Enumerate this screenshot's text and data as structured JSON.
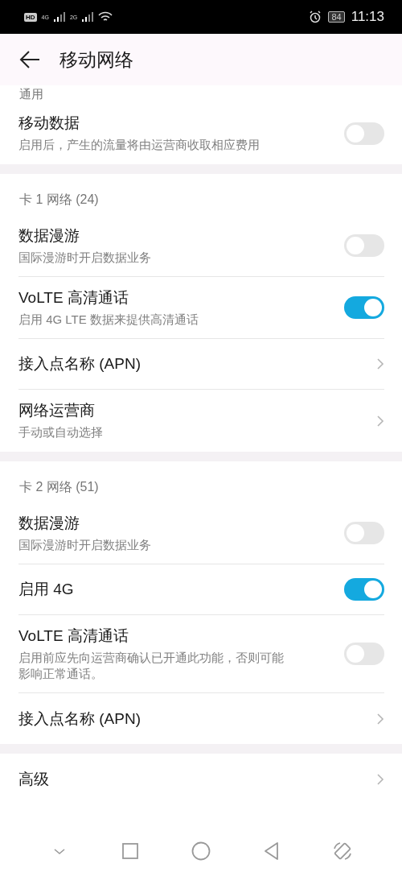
{
  "status_bar": {
    "left": [
      "HD",
      "4G",
      "2G"
    ],
    "battery": "84",
    "time": "11:13"
  },
  "header": {
    "title": "移动网络"
  },
  "sections": [
    {
      "title": "通用",
      "items": [
        {
          "kind": "toggle",
          "title": "移动数据",
          "subtitle": "启用后，产生的流量将由运营商收取相应费用",
          "on": false
        }
      ]
    },
    {
      "title": "卡 1 网络 (24)",
      "items": [
        {
          "kind": "toggle",
          "title": "数据漫游",
          "subtitle": "国际漫游时开启数据业务",
          "on": false
        },
        {
          "kind": "toggle",
          "title": "VoLTE 高清通话",
          "subtitle": "启用 4G LTE 数据来提供高清通话",
          "on": true
        },
        {
          "kind": "link",
          "title": "接入点名称 (APN)"
        },
        {
          "kind": "link",
          "title": "网络运营商",
          "subtitle": "手动或自动选择"
        }
      ]
    },
    {
      "title": "卡 2 网络 (51)",
      "items": [
        {
          "kind": "toggle",
          "title": "数据漫游",
          "subtitle": "国际漫游时开启数据业务",
          "on": false
        },
        {
          "kind": "toggle",
          "title": "启用 4G",
          "on": true
        },
        {
          "kind": "toggle",
          "title": "VoLTE 高清通话",
          "subtitle": "启用前应先向运营商确认已开通此功能，否则可能影响正常通话。",
          "on": false
        },
        {
          "kind": "link",
          "title": "接入点名称 (APN)"
        }
      ]
    },
    {
      "items": [
        {
          "kind": "link",
          "title": "高级"
        }
      ]
    }
  ]
}
